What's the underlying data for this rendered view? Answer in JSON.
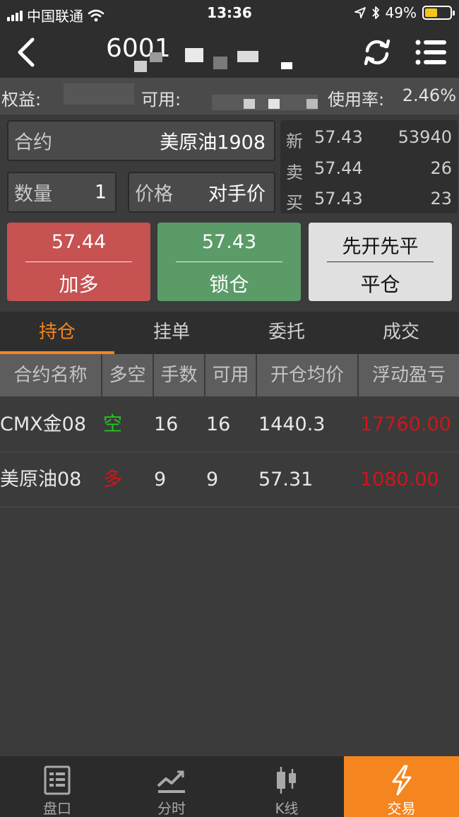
{
  "status_bar": {
    "carrier": "中国联通",
    "time": "13:36",
    "battery_percent": "49%",
    "battery_level": 0.49
  },
  "nav": {
    "title": "6001",
    "icons": [
      "back-arrow-icon",
      "refresh-icon",
      "menu-list-icon"
    ]
  },
  "account": {
    "equity_label": "权益:",
    "available_label": "可用:",
    "usage_label": "使用率:",
    "usage_value": "2.46%"
  },
  "order_form": {
    "contract_label": "合约",
    "contract_value": "美原油1908",
    "quantity_label": "数量",
    "quantity_value": "1",
    "price_label": "价格",
    "price_value": "对手价"
  },
  "quote": {
    "rows": [
      {
        "label": "新",
        "price": "57.43",
        "volume": "53940"
      },
      {
        "label": "卖",
        "price": "57.44",
        "volume": "26"
      },
      {
        "label": "买",
        "price": "57.43",
        "volume": "23"
      }
    ]
  },
  "actions": {
    "buy": {
      "price": "57.44",
      "label": "加多",
      "color": "#c65251"
    },
    "lock": {
      "price": "57.43",
      "label": "锁仓",
      "color": "#5a9b68"
    },
    "close": {
      "mode": "先开先平",
      "label": "平仓",
      "color": "#e0e0e0"
    }
  },
  "tabs": [
    {
      "label": "持仓",
      "active": true
    },
    {
      "label": "挂单",
      "active": false
    },
    {
      "label": "委托",
      "active": false
    },
    {
      "label": "成交",
      "active": false
    }
  ],
  "accent_color": "#f5851f",
  "positions": {
    "columns": [
      "合约名称",
      "多空",
      "手数",
      "可用",
      "开仓均价",
      "浮动盈亏"
    ],
    "rows": [
      {
        "name": "CMX金08",
        "direction": "空",
        "direction_color": "#22c322",
        "lots": "16",
        "available": "16",
        "avg_price": "1440.3",
        "pnl": "17760.00",
        "pnl_color": "#d0151a"
      },
      {
        "name": "美原油08",
        "direction": "多",
        "direction_color": "#d0151a",
        "lots": "9",
        "available": "9",
        "avg_price": "57.31",
        "pnl": "1080.00",
        "pnl_color": "#d0151a"
      }
    ]
  },
  "bottom_nav": [
    {
      "label": "盘口",
      "icon": "order-book-icon",
      "active": false
    },
    {
      "label": "分时",
      "icon": "timeshare-chart-icon",
      "active": false
    },
    {
      "label": "K线",
      "icon": "candlestick-icon",
      "active": false
    },
    {
      "label": "交易",
      "icon": "lightning-icon",
      "active": true
    }
  ]
}
